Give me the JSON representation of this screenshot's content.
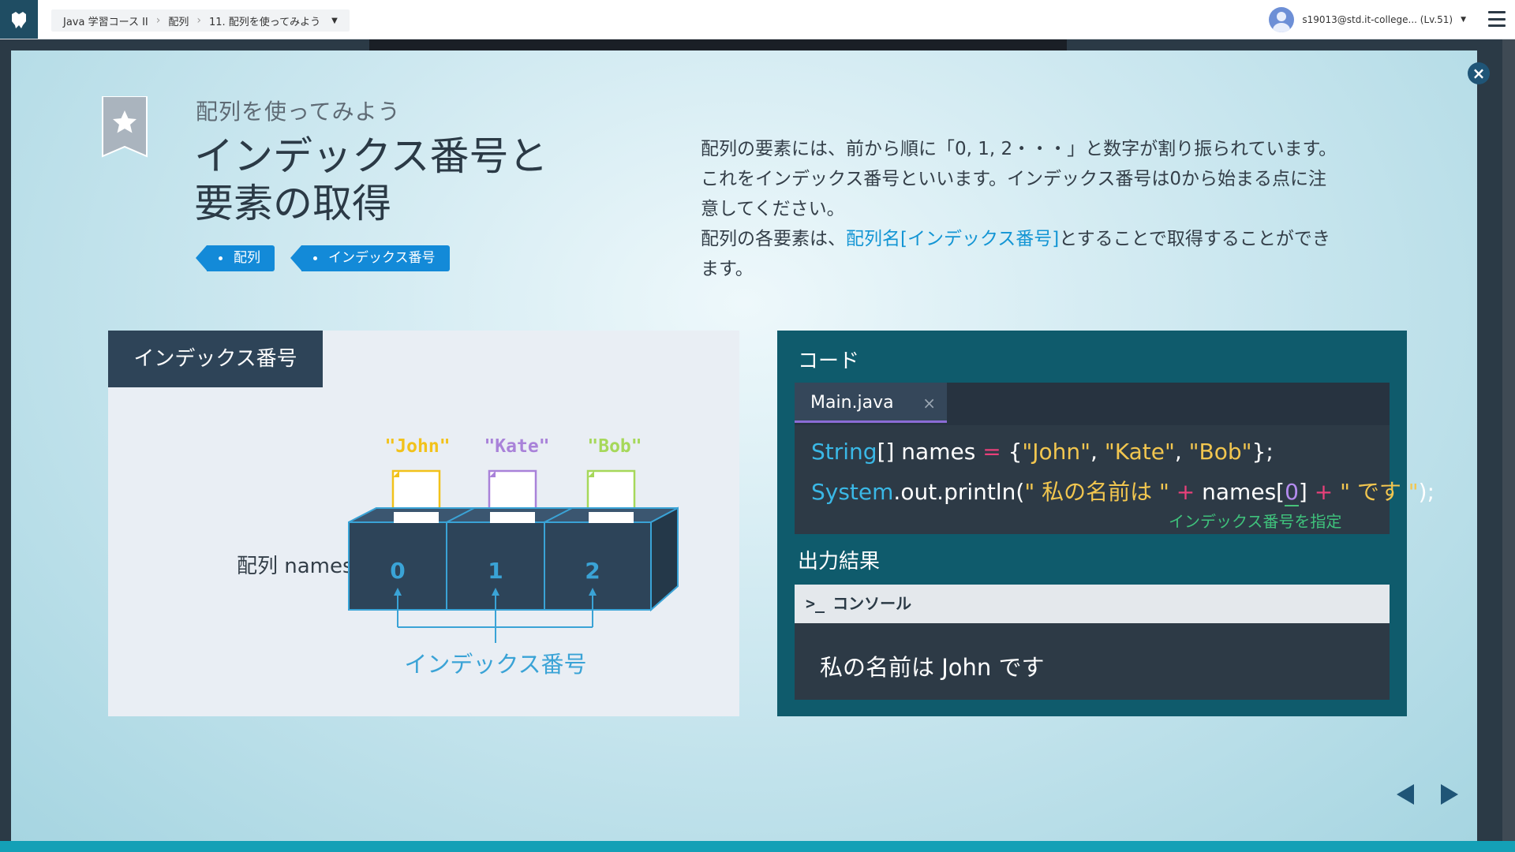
{
  "topbar": {
    "breadcrumb": [
      "Java 学習コース II",
      "配列",
      "11. 配列を使ってみよう"
    ],
    "user_label": "s19013@std.it-college... (Lv.51)"
  },
  "lesson": {
    "subtitle": "配列を使ってみよう",
    "title_line1": "インデックス番号と",
    "title_line2": "要素の取得",
    "tags": [
      "配列",
      "インデックス番号"
    ],
    "desc_line1": "配列の要素には、前から順に「0, 1, 2・・・」と数字が割り振られています。",
    "desc_line2": "これをインデックス番号といいます。インデックス番号は0から始まる点に注",
    "desc_line3": "意してください。",
    "desc_line4_pre": "配列の各要素は、",
    "desc_line4_hl": "配列名[インデックス番号]",
    "desc_line4_post": "とすることで取得することができ",
    "desc_line5": "ます。"
  },
  "diagram": {
    "header": "インデックス番号",
    "array_label": "配列 names",
    "elements": [
      "\"John\"",
      "\"Kate\"",
      "\"Bob\""
    ],
    "indices": [
      "0",
      "1",
      "2"
    ],
    "caption": "インデックス番号",
    "colors": {
      "john": "#f2c21b",
      "kate": "#a982d9",
      "bob": "#a6d85a",
      "box": "#2d4459",
      "edge": "#3aa3d6"
    }
  },
  "code": {
    "header": "コード",
    "tab_name": "Main.java",
    "tab_close": "×",
    "line1": {
      "kw": "String",
      "a": "[] names ",
      "op": "=",
      "b": " {",
      "s1": "\"John\"",
      "c1": ", ",
      "s2": "\"Kate\"",
      "c2": ", ",
      "s3": "\"Bob\"",
      "end": "};"
    },
    "line2": {
      "kw": "System",
      "a": ".out.println(",
      "s1": "\" 私の名前は \"",
      "op1": " + ",
      "b": "names[",
      "idx": "0",
      "c": "]",
      "op2": " + ",
      "s2": "\" です \"",
      "end": ");"
    },
    "note": "インデックス番号を指定",
    "output_header": "出力結果",
    "console_prompt": ">_",
    "console_label": "コンソール",
    "console_output": "私の名前は John です"
  }
}
